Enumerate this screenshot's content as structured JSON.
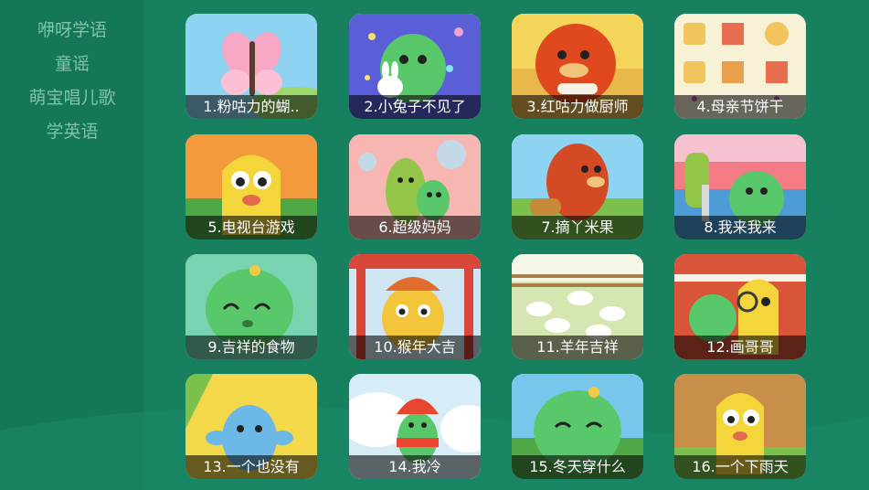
{
  "sidebar": {
    "items": [
      {
        "label": "咿呀学语"
      },
      {
        "label": "童谣"
      },
      {
        "label": "萌宝唱儿歌"
      },
      {
        "label": "学英语"
      }
    ]
  },
  "videos": [
    {
      "title": "1.粉咕力的蝴.."
    },
    {
      "title": "2.小兔子不见了"
    },
    {
      "title": "3.红咕力做厨师"
    },
    {
      "title": "4.母亲节饼干"
    },
    {
      "title": "5.电视台游戏"
    },
    {
      "title": "6.超级妈妈"
    },
    {
      "title": "7.摘丫米果"
    },
    {
      "title": "8.我来我来"
    },
    {
      "title": "9.吉祥的食物"
    },
    {
      "title": "10.猴年大吉"
    },
    {
      "title": "11.羊年吉祥"
    },
    {
      "title": "12.画哥哥"
    },
    {
      "title": "13.一个也没有"
    },
    {
      "title": "14.我冷"
    },
    {
      "title": "15.冬天穿什么"
    },
    {
      "title": "16.一个下雨天"
    }
  ],
  "colors": {
    "background": "#16805f",
    "sidebar": "#14775a",
    "sidebar_text": "#7fc3a9",
    "caption_bg": "#000000"
  }
}
